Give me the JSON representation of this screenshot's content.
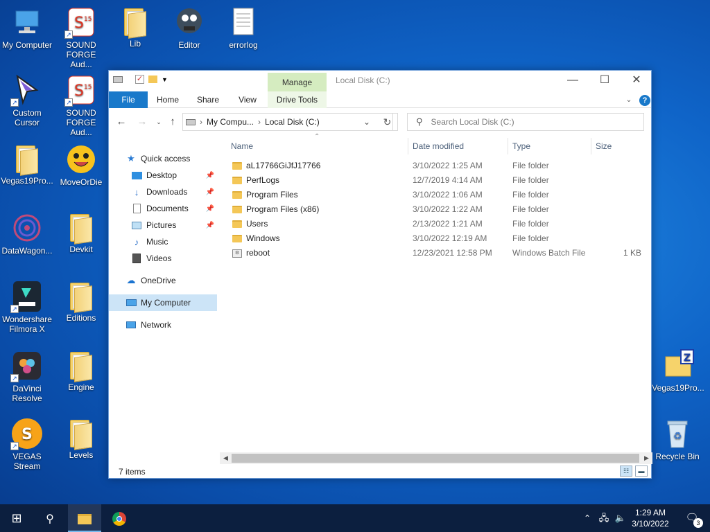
{
  "desktop": {
    "icons": [
      {
        "label": "My Computer"
      },
      {
        "label": "SOUND FORGE Aud..."
      },
      {
        "label": "Lib"
      },
      {
        "label": "Editor"
      },
      {
        "label": "errorlog"
      },
      {
        "label": "Custom Cursor"
      },
      {
        "label": "SOUND FORGE Aud..."
      },
      {
        "label": "Vegas19Pro..."
      },
      {
        "label": "MoveOrDie"
      },
      {
        "label": "DataWagon..."
      },
      {
        "label": "Devkit"
      },
      {
        "label": "Wondershare Filmora X"
      },
      {
        "label": "Editions"
      },
      {
        "label": "DaVinci Resolve"
      },
      {
        "label": "Engine"
      },
      {
        "label": "VEGAS Stream"
      },
      {
        "label": "Levels"
      },
      {
        "label": "Vegas19Pro..."
      },
      {
        "label": "Recycle Bin"
      }
    ]
  },
  "window": {
    "title": "Local Disk (C:)",
    "context_tab": "Manage",
    "ribbon_tabs": [
      "File",
      "Home",
      "Share",
      "View",
      "Drive Tools"
    ],
    "address": {
      "parent": "My Compu...",
      "current": "Local Disk (C:)"
    },
    "search_placeholder": "Search Local Disk (C:)",
    "nav": {
      "quick_access": "Quick access",
      "desktop": "Desktop",
      "downloads": "Downloads",
      "documents": "Documents",
      "pictures": "Pictures",
      "music": "Music",
      "videos": "Videos",
      "onedrive": "OneDrive",
      "my_computer": "My Computer",
      "network": "Network"
    },
    "columns": {
      "name": "Name",
      "date": "Date modified",
      "type": "Type",
      "size": "Size"
    },
    "files": [
      {
        "name": "aL17766GiJfJ17766",
        "date": "3/10/2022 1:25 AM",
        "type": "File folder",
        "size": "",
        "kind": "folder"
      },
      {
        "name": "PerfLogs",
        "date": "12/7/2019 4:14 AM",
        "type": "File folder",
        "size": "",
        "kind": "folder"
      },
      {
        "name": "Program Files",
        "date": "3/10/2022 1:06 AM",
        "type": "File folder",
        "size": "",
        "kind": "folder"
      },
      {
        "name": "Program Files (x86)",
        "date": "3/10/2022 1:22 AM",
        "type": "File folder",
        "size": "",
        "kind": "folder"
      },
      {
        "name": "Users",
        "date": "2/13/2022 1:21 AM",
        "type": "File folder",
        "size": "",
        "kind": "folder"
      },
      {
        "name": "Windows",
        "date": "3/10/2022 12:19 AM",
        "type": "File folder",
        "size": "",
        "kind": "folder"
      },
      {
        "name": "reboot",
        "date": "12/23/2021 12:58 PM",
        "type": "Windows Batch File",
        "size": "1 KB",
        "kind": "batch"
      }
    ],
    "status": "7 items"
  },
  "taskbar": {
    "time": "1:29 AM",
    "date": "3/10/2022",
    "notification_count": "3"
  },
  "colors": {
    "accent": "#1979ca",
    "selection": "#cce4f7",
    "manage": "#d5ecc0",
    "taskbar": "#0c1f3f"
  }
}
